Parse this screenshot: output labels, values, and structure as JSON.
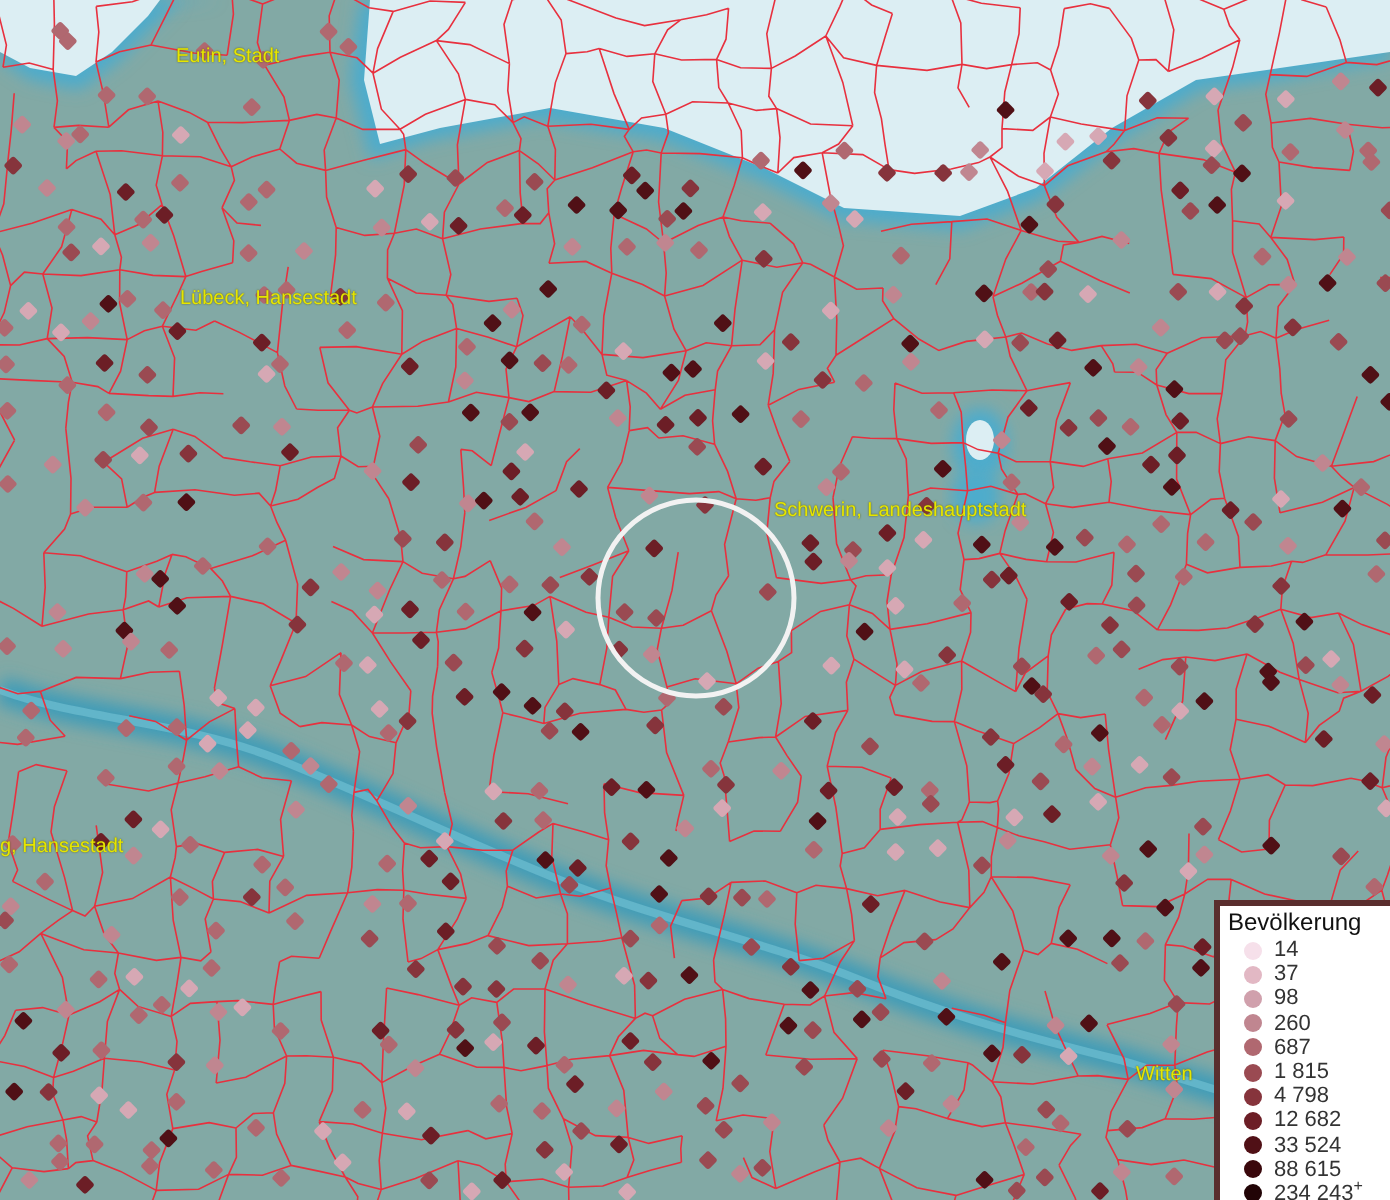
{
  "map": {
    "places": [
      {
        "name": "Eutin, Stadt"
      },
      {
        "name": "Lübeck, Hansestadt"
      },
      {
        "name": "Schwerin, Landeshauptstadt"
      },
      {
        "name": "g, Hansestadt"
      },
      {
        "name": "Witten"
      }
    ]
  },
  "legend": {
    "title": "Bevölkerung",
    "items": [
      {
        "label": "14",
        "color": "#f6e0ea"
      },
      {
        "label": "37",
        "color": "#e2b8c4"
      },
      {
        "label": "98",
        "color": "#d0a0ac"
      },
      {
        "label": "260",
        "color": "#c08690"
      },
      {
        "label": "687",
        "color": "#b06870"
      },
      {
        "label": "1 815",
        "color": "#9a4a52"
      },
      {
        "label": "4 798",
        "color": "#86343c"
      },
      {
        "label": "12 682",
        "color": "#6c1e26"
      },
      {
        "label": "33 524",
        "color": "#501016"
      },
      {
        "label": "88 615",
        "color": "#3a080c"
      },
      {
        "label": "234 243$^{+}$",
        "color": "#220406"
      }
    ]
  }
}
